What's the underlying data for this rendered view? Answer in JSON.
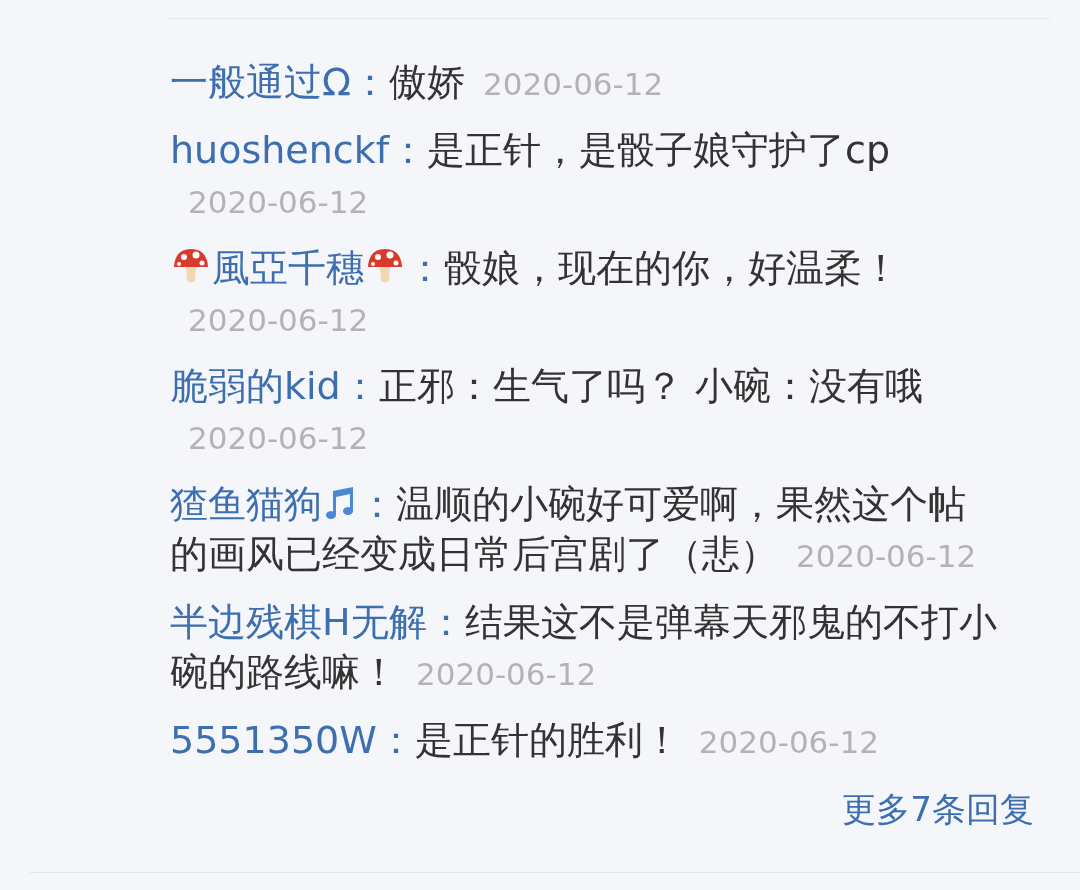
{
  "replies": [
    {
      "user": "一般通过Ω：",
      "text": "傲娇",
      "date": "2020-06-12"
    },
    {
      "user": "huoshenckf：",
      "text": "是正针，是骰子娘守护了cp",
      "date": "2020-06-12"
    },
    {
      "user": "風亞千穗",
      "icon_before": {
        "kind": "mushroom"
      },
      "icon_after": {
        "kind": "mushroom"
      },
      "user_suffix": "：",
      "text": "骰娘，现在的你，好温柔！",
      "date": "2020-06-12"
    },
    {
      "user": "脆弱的kid：",
      "text": "正邪：生气了吗？ 小碗：没有哦",
      "date": "2020-06-12"
    },
    {
      "user": "猹鱼猫狗",
      "icon_after": {
        "kind": "note"
      },
      "user_suffix": "：",
      "text": "温顺的小碗好可爱啊，果然这个帖的画风已经变成日常后宫剧了（悲）",
      "date": "2020-06-12"
    },
    {
      "user": "半边残棋H无解：",
      "text": "结果这不是弹幕天邪鬼的不打小碗的路线嘛！",
      "date": "2020-06-12"
    },
    {
      "user": "5551350W：",
      "text": "是正针的胜利！",
      "date": "2020-06-12"
    }
  ],
  "more_link": "更多7条回复"
}
